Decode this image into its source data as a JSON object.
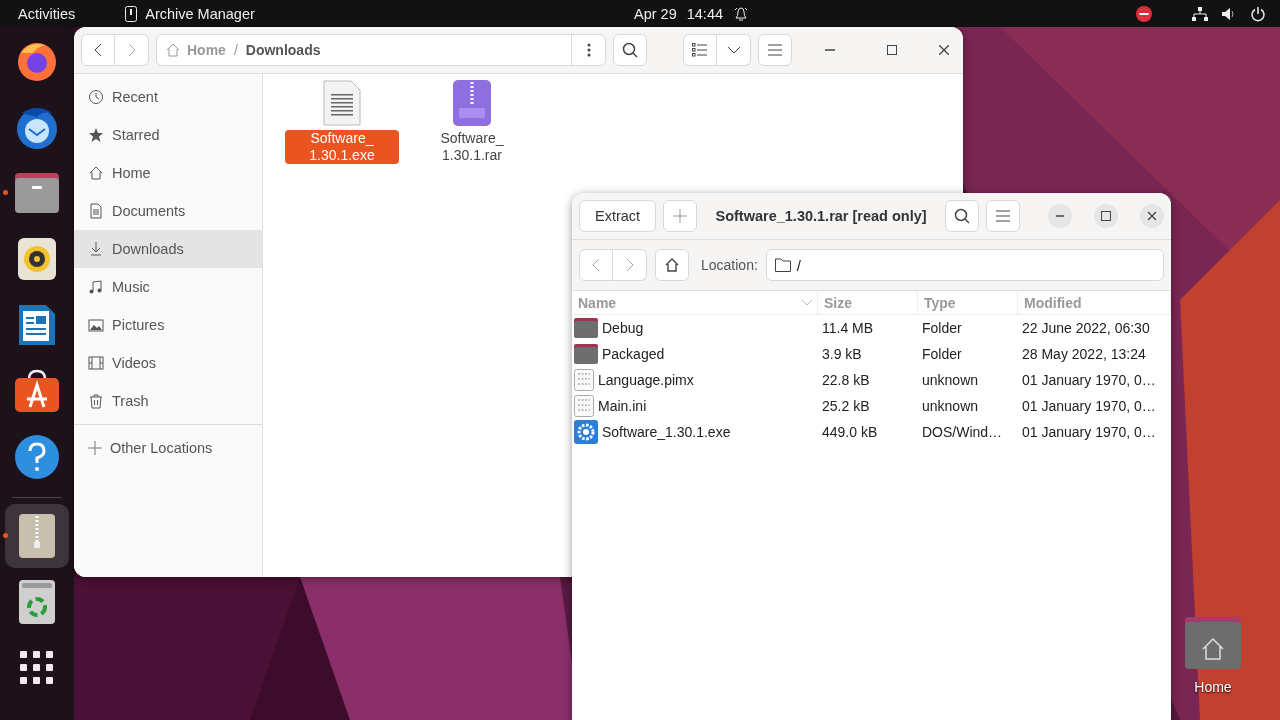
{
  "top_bar": {
    "activities": "Activities",
    "app_name": "Archive Manager",
    "date": "Apr 29",
    "time": "14:44"
  },
  "dock": {
    "items": [
      {
        "kind": "firefox",
        "running": false,
        "selected": false
      },
      {
        "kind": "thunderbird",
        "running": false,
        "selected": false
      },
      {
        "kind": "files",
        "running": true,
        "selected": false
      },
      {
        "kind": "rhythmbox",
        "running": false,
        "selected": false
      },
      {
        "kind": "writer",
        "running": false,
        "selected": false
      },
      {
        "kind": "software",
        "running": false,
        "selected": false
      },
      {
        "kind": "help",
        "running": false,
        "selected": false
      },
      {
        "kind": "archive",
        "running": true,
        "selected": true
      },
      {
        "kind": "trash",
        "running": false,
        "selected": false
      },
      {
        "kind": "apps",
        "running": false,
        "selected": false
      }
    ]
  },
  "files_window": {
    "path": [
      "Home",
      "Downloads"
    ],
    "path_separator": "/",
    "sidebar": {
      "items": [
        {
          "kind": "recent",
          "label": "Recent",
          "selected": false
        },
        {
          "kind": "starred",
          "label": "Starred",
          "selected": false
        },
        {
          "kind": "home",
          "label": "Home",
          "selected": false
        },
        {
          "kind": "documents",
          "label": "Documents",
          "selected": false
        },
        {
          "kind": "downloads",
          "label": "Downloads",
          "selected": true
        },
        {
          "kind": "music",
          "label": "Music",
          "selected": false
        },
        {
          "kind": "pictures",
          "label": "Pictures",
          "selected": false
        },
        {
          "kind": "videos",
          "label": "Videos",
          "selected": false
        },
        {
          "kind": "trash",
          "label": "Trash",
          "selected": false
        }
      ],
      "other": {
        "label": "Other Locations"
      }
    },
    "files": [
      {
        "kind": "document",
        "name": "Software_1.30.1.exe",
        "selected": true
      },
      {
        "kind": "rar",
        "name": "Software_1.30.1.rar",
        "selected": false
      }
    ]
  },
  "archive_window": {
    "title": "Software_1.30.1.rar [read only]",
    "extract": "Extract",
    "location_label": "Location:",
    "location": "/",
    "columns": [
      "Name",
      "Size",
      "Type",
      "Modified"
    ],
    "rows": [
      {
        "kind": "folder",
        "name": "Debug",
        "size": "11.4 MB",
        "type": "Folder",
        "modified": "22 June 2022, 06:30"
      },
      {
        "kind": "folder",
        "name": "Packaged",
        "size": "3.9 kB",
        "type": "Folder",
        "modified": "28 May 2022, 13:24"
      },
      {
        "kind": "binary",
        "name": "Language.pimx",
        "size": "22.8 kB",
        "type": "unknown",
        "modified": "01 January 1970, 0…"
      },
      {
        "kind": "binary",
        "name": "Main.ini",
        "size": "25.2 kB",
        "type": "unknown",
        "modified": "01 January 1970, 0…"
      },
      {
        "kind": "executable",
        "name": "Software_1.30.1.exe",
        "size": "449.0 kB",
        "type": "DOS/Wind…",
        "modified": "01 January 1970, 0…"
      }
    ]
  },
  "desktop": {
    "icons": [
      {
        "label": "Home"
      }
    ]
  }
}
